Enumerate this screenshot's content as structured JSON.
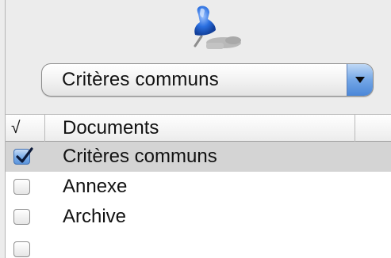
{
  "popup": {
    "selected_value": "Critères communs"
  },
  "table": {
    "header": {
      "check_column": "√",
      "name_column": "Documents"
    },
    "rows": [
      {
        "label": "Critères communs",
        "checked": true
      },
      {
        "label": "Annexe",
        "checked": false
      },
      {
        "label": "Archive",
        "checked": false
      }
    ]
  },
  "icons": {
    "pin": "pushpin-icon",
    "popup_arrow": "chevron-down-icon",
    "checkmark": "checkmark-icon"
  },
  "colors": {
    "selection_bg": "#d4d4d4",
    "accent_blue": "#4b87d8",
    "pin_blue": "#2a6fe0"
  }
}
